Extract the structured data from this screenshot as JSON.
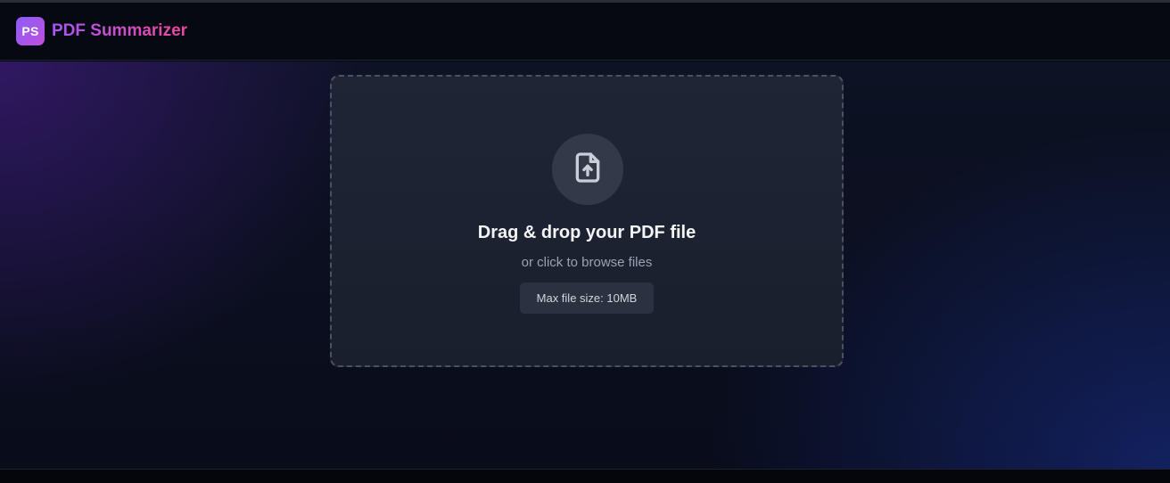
{
  "header": {
    "logo_initials": "PS",
    "app_name": "PDF Summarizer"
  },
  "dropzone": {
    "icon": "file-upload-icon",
    "title": "Drag & drop your PDF file",
    "subtitle": "or click to browse files",
    "max_size_label": "Max file size: 10MB"
  },
  "colors": {
    "accent_purple": "#8b5cf6",
    "accent_pink": "#ec4899",
    "background": "#0b0f1e",
    "dropzone_bg": "#1f2535"
  }
}
